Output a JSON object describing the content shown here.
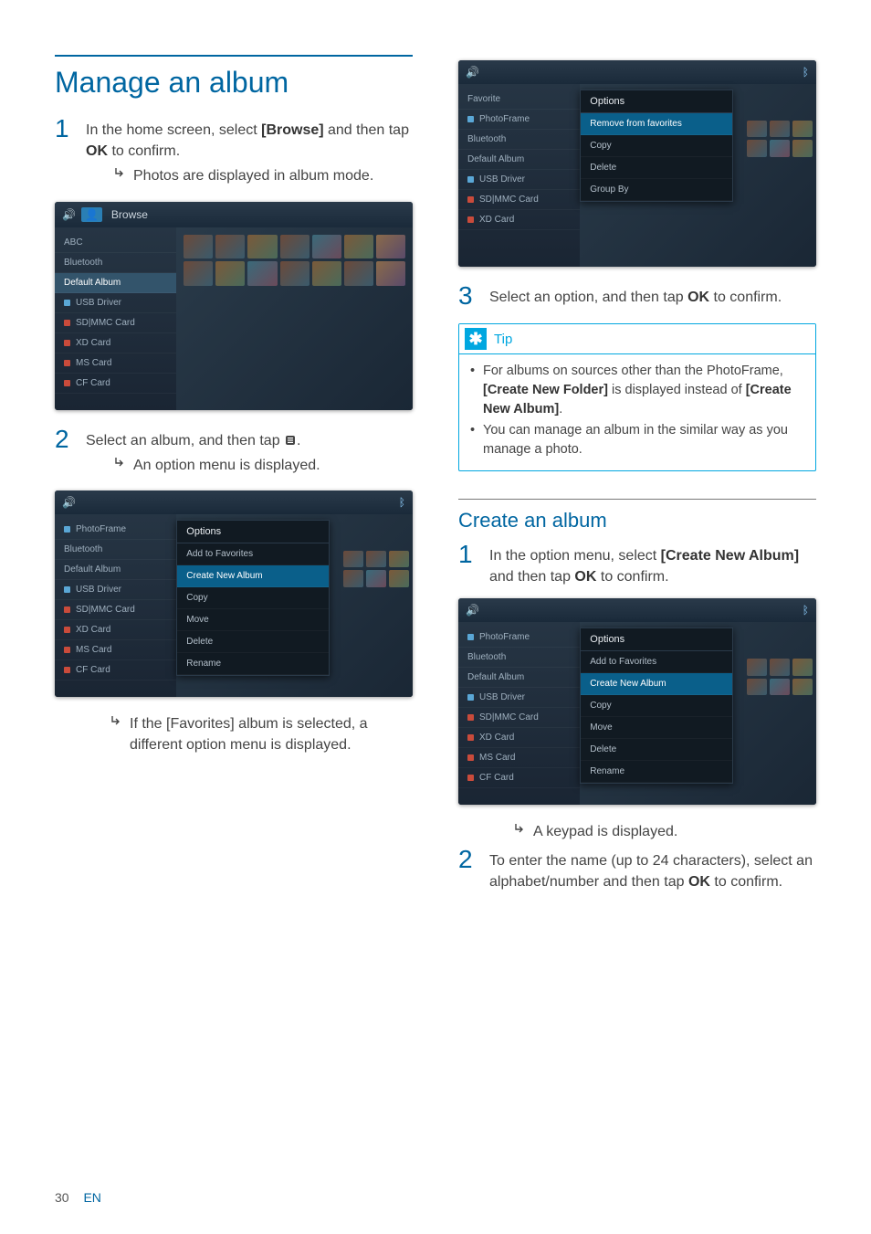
{
  "page": {
    "number": "30",
    "lang": "EN"
  },
  "section_title": "Manage an album",
  "steps_left": {
    "s1": {
      "pre": "In the home screen, select ",
      "bold1": "[Browse]",
      "mid": " and then tap ",
      "bold2": "OK",
      "post": " to confirm."
    },
    "r1": "Photos are displayed in album mode.",
    "s2": {
      "pre": "Select an album, and then tap ",
      "icon_name": "menu-icon",
      "post": "."
    },
    "r2": "An option menu is displayed.",
    "r3_pre": "If the ",
    "r3_bold": "[Favorites]",
    "r3_post": " album is selected, a different option menu is displayed."
  },
  "steps_right": {
    "s3": {
      "pre": "Select an option, and then tap ",
      "bold": "OK",
      "post": " to confirm."
    }
  },
  "tip": {
    "label": "Tip",
    "li1_pre": "For albums on sources other than the PhotoFrame, ",
    "li1_bold1": "[Create New Folder]",
    "li1_mid": " is displayed instead of ",
    "li1_bold2": "[Create New Album]",
    "li1_post": ".",
    "li2": "You can manage an album in the similar way as you manage a photo."
  },
  "subsection_title": "Create an album",
  "create": {
    "s1_pre": "In the option menu, select ",
    "s1_bold1": "[Create New Album]",
    "s1_mid": " and then tap ",
    "s1_bold2": "OK",
    "s1_post": " to confirm.",
    "r1": "A keypad is displayed.",
    "s2_pre": "To enter the name (up to 24 characters), select an alphabet/number and then tap ",
    "s2_bold": "OK",
    "s2_post": " to confirm."
  },
  "ss1": {
    "title": "Browse",
    "items": [
      "ABC",
      "Bluetooth",
      "Default Album",
      "USB Driver",
      "SD|MMC Card",
      "XD Card",
      "MS Card",
      "CF Card"
    ],
    "selected_index": 2
  },
  "ss2": {
    "popup_title": "Options",
    "popup_items": [
      "Add to Favorites",
      "Create New Album",
      "Copy",
      "Move",
      "Delete",
      "Rename"
    ],
    "popup_sel": 1,
    "side": [
      "PhotoFrame",
      "Bluetooth",
      "Default Album",
      "USB Driver",
      "SD|MMC Card",
      "XD Card",
      "MS Card",
      "CF Card"
    ]
  },
  "ss3": {
    "popup_title": "Options",
    "popup_items": [
      "Remove from favorites",
      "Copy",
      "Delete",
      "Group By"
    ],
    "popup_sel": 0,
    "side": [
      "Favorite",
      "PhotoFrame",
      "Bluetooth",
      "Default Album",
      "USB Driver",
      "SD|MMC Card",
      "XD Card"
    ]
  },
  "ss4": {
    "popup_title": "Options",
    "popup_items": [
      "Add to Favorites",
      "Create New Album",
      "Copy",
      "Move",
      "Delete",
      "Rename"
    ],
    "popup_sel": 1,
    "side": [
      "PhotoFrame",
      "Bluetooth",
      "Default Album",
      "USB Driver",
      "SD|MMC Card",
      "XD Card",
      "MS Card",
      "CF Card"
    ]
  }
}
